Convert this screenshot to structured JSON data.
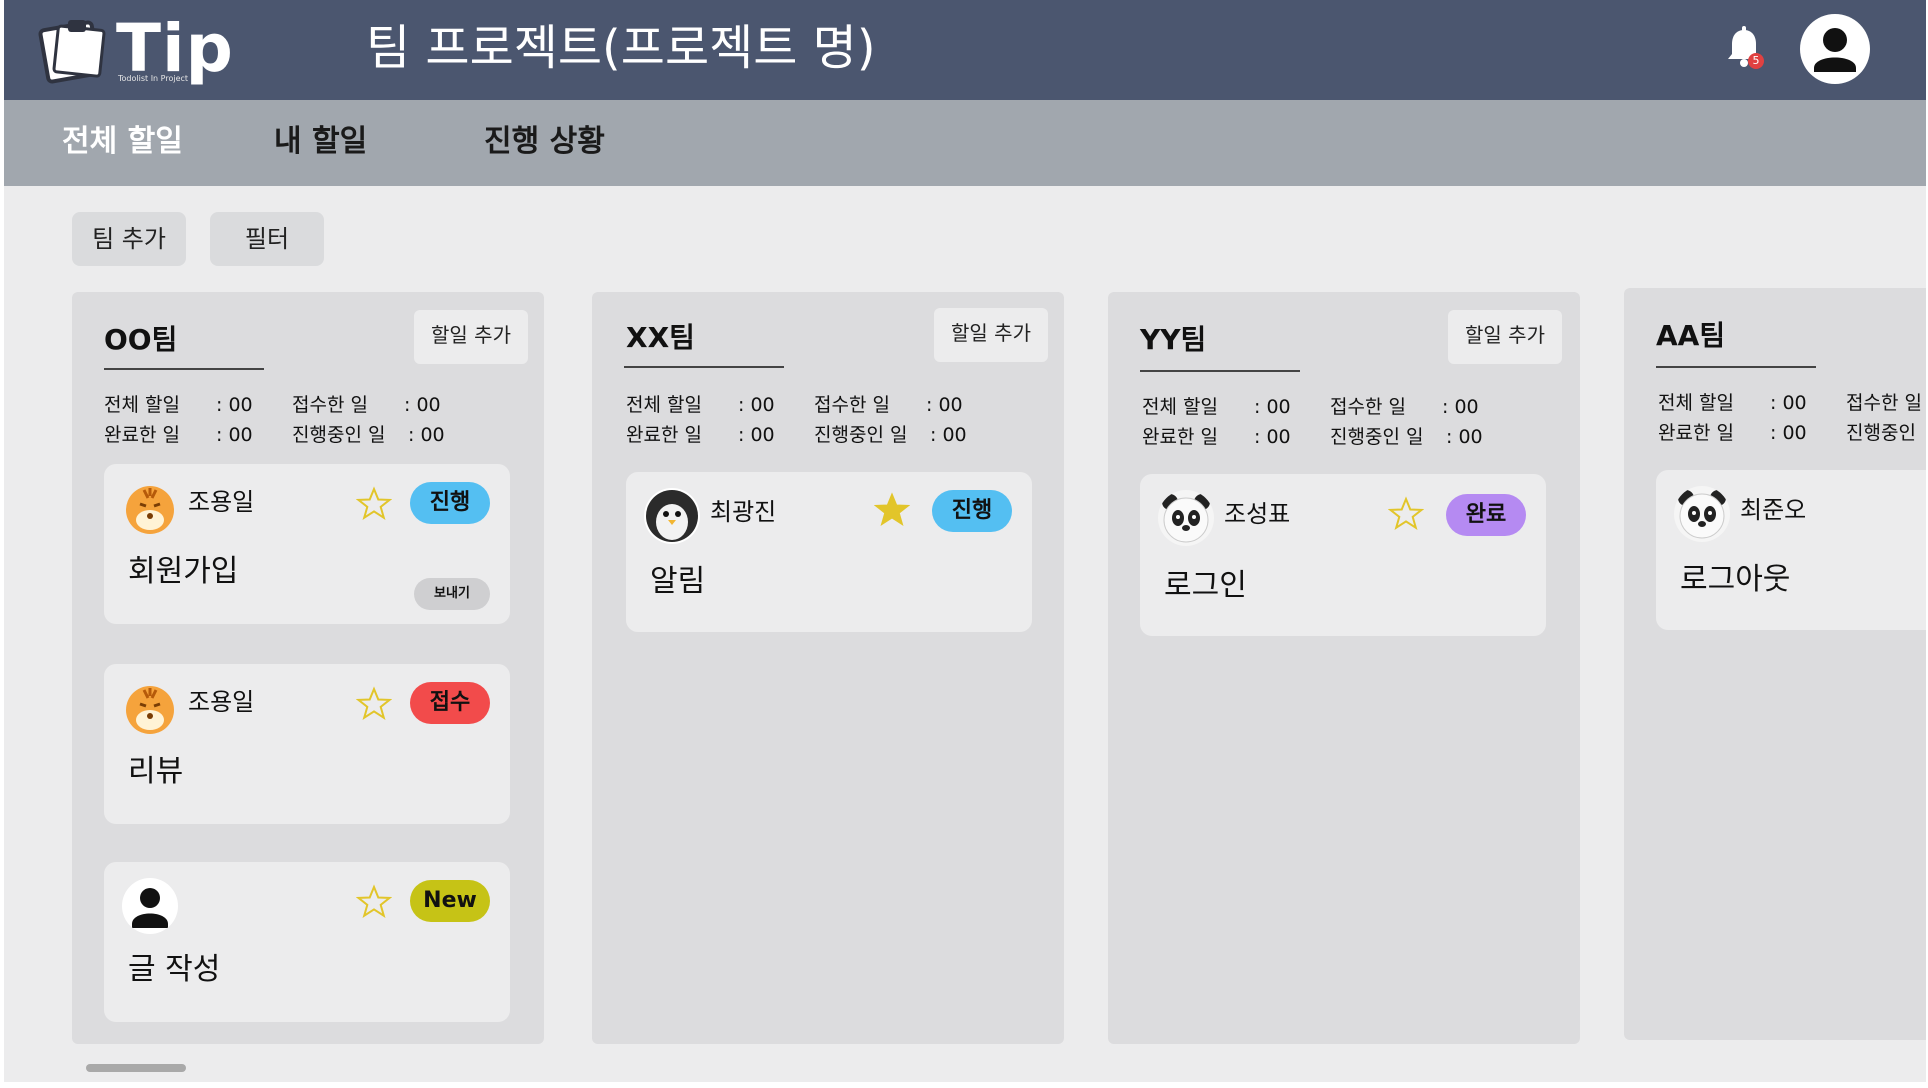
{
  "app": {
    "logo_text": "Tip",
    "logo_subtitle": "Todolist In Project",
    "project_title": "팀 프로젝트(프로젝트 명)",
    "notification_count": "5"
  },
  "nav": {
    "tabs": [
      {
        "label": "전체 할일",
        "active": true
      },
      {
        "label": "내 할일",
        "active": false
      },
      {
        "label": "진행 상황",
        "active": false
      }
    ]
  },
  "toolbar": {
    "add_team_label": "팀 추가",
    "filter_label": "필터"
  },
  "columns": [
    {
      "title": "OO팀",
      "add_label": "할일 추가",
      "stats": {
        "total": "전체 할일",
        "total_val": ": 00",
        "received": "접수한 일",
        "received_val": ": 00",
        "done": "완료한 일",
        "done_val": ": 00",
        "progress": "진행중인 일",
        "progress_val": ":  00"
      },
      "cards": [
        {
          "user": "조용일",
          "avatar": "tiger-avatar-icon",
          "starred": false,
          "status": "진행",
          "status_color": "#54bff2",
          "title": "회원가입",
          "send_label": "보내기"
        },
        {
          "user": "조용일",
          "avatar": "tiger-avatar-icon",
          "starred": false,
          "status": "접수",
          "status_color": "#f24b4b",
          "title": "리뷰"
        },
        {
          "user": "",
          "avatar": "user-avatar-icon",
          "starred": false,
          "status": "New",
          "status_color": "#c6c316",
          "title": "글 작성"
        }
      ]
    },
    {
      "title": "XX팀",
      "add_label": "할일 추가",
      "stats": {
        "total": "전체 할일",
        "total_val": ": 00",
        "received": "접수한 일",
        "received_val": ": 00",
        "done": "완료한 일",
        "done_val": ": 00",
        "progress": "진행중인 일",
        "progress_val": ":  00"
      },
      "cards": [
        {
          "user": "최광진",
          "avatar": "penguin-avatar-icon",
          "starred": true,
          "status": "진행",
          "status_color": "#54bff2",
          "title": "알림"
        }
      ]
    },
    {
      "title": "YY팀",
      "add_label": "할일 추가",
      "stats": {
        "total": "전체 할일",
        "total_val": ": 00",
        "received": "접수한 일",
        "received_val": ": 00",
        "done": "완료한 일",
        "done_val": ": 00",
        "progress": "진행중인 일",
        "progress_val": ":  00"
      },
      "cards": [
        {
          "user": "조성표",
          "avatar": "panda-avatar-icon",
          "starred": false,
          "status": "완료",
          "status_color": "#b58af2",
          "title": "로그인"
        }
      ]
    },
    {
      "title": "AA팀",
      "stats": {
        "total": "전체 할일",
        "total_val": ": 00",
        "received": "접수한 일",
        "done": "완료한 일",
        "done_val": ": 00",
        "progress": "진행중인"
      },
      "cards": [
        {
          "user": "최준오",
          "avatar": "panda-avatar-icon",
          "title": "로그아웃"
        }
      ]
    }
  ]
}
